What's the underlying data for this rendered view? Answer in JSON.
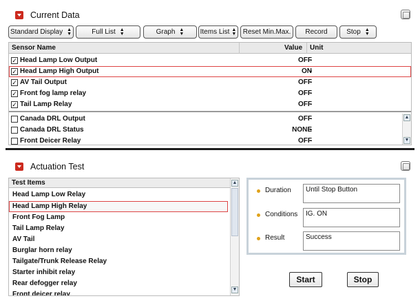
{
  "current_data": {
    "title": "Current Data",
    "toolbar": {
      "standard_display": "Standard Display",
      "full_list": "Full List",
      "graph": "Graph",
      "items_list": "Items List",
      "reset_minmax": "Reset Min.Max.",
      "record": "Record",
      "stop": "Stop"
    },
    "columns": {
      "name": "Sensor Name",
      "value": "Value",
      "unit": "Unit"
    },
    "rows": [
      {
        "name": "Head Lamp Low Output",
        "value": "OFF",
        "unit": "-",
        "checked": true
      },
      {
        "name": "Head Lamp High Output",
        "value": "ON",
        "unit": "-",
        "checked": true
      },
      {
        "name": "AV Tail Output",
        "value": "OFF",
        "unit": "-",
        "checked": true
      },
      {
        "name": "Front fog lamp relay",
        "value": "OFF",
        "unit": "-",
        "checked": true
      },
      {
        "name": "Tail Lamp Relay",
        "value": "OFF",
        "unit": "-",
        "checked": true
      },
      {
        "name": "Canada DRL Output",
        "value": "OFF",
        "unit": "-",
        "checked": false
      },
      {
        "name": "Canada DRL Status",
        "value": "NONE",
        "unit": "-",
        "checked": false
      },
      {
        "name": "Front Deicer Relay",
        "value": "OFF",
        "unit": "-",
        "checked": false
      }
    ]
  },
  "actuation_test": {
    "title": "Actuation Test",
    "list_header": "Test Items",
    "items": [
      "Head Lamp Low Relay",
      "Head Lamp High Relay",
      "Front Fog Lamp",
      "Tail Lamp Relay",
      "AV Tail",
      "Burglar horn relay",
      "Tailgate/Trunk Release Relay",
      "Starter inhibit relay",
      "Rear defogger relay",
      "Front deicer relay"
    ],
    "info": {
      "duration_label": "Duration",
      "duration_value": "Until Stop Button",
      "conditions_label": "Conditions",
      "conditions_value": "IG. ON",
      "result_label": "Result",
      "result_value": "Success"
    },
    "start_label": "Start",
    "stop_label": "Stop"
  },
  "colors": {
    "accent_red": "#cc2a1e",
    "selection_outline": "#dd4444",
    "bullet": "#e0a21a"
  },
  "icons": [
    "collapse-arrow-icon",
    "window-restore-icon",
    "checkbox-icon",
    "scroll-up-arrow-icon",
    "scroll-down-arrow-icon",
    "bullet-dot-icon"
  ]
}
